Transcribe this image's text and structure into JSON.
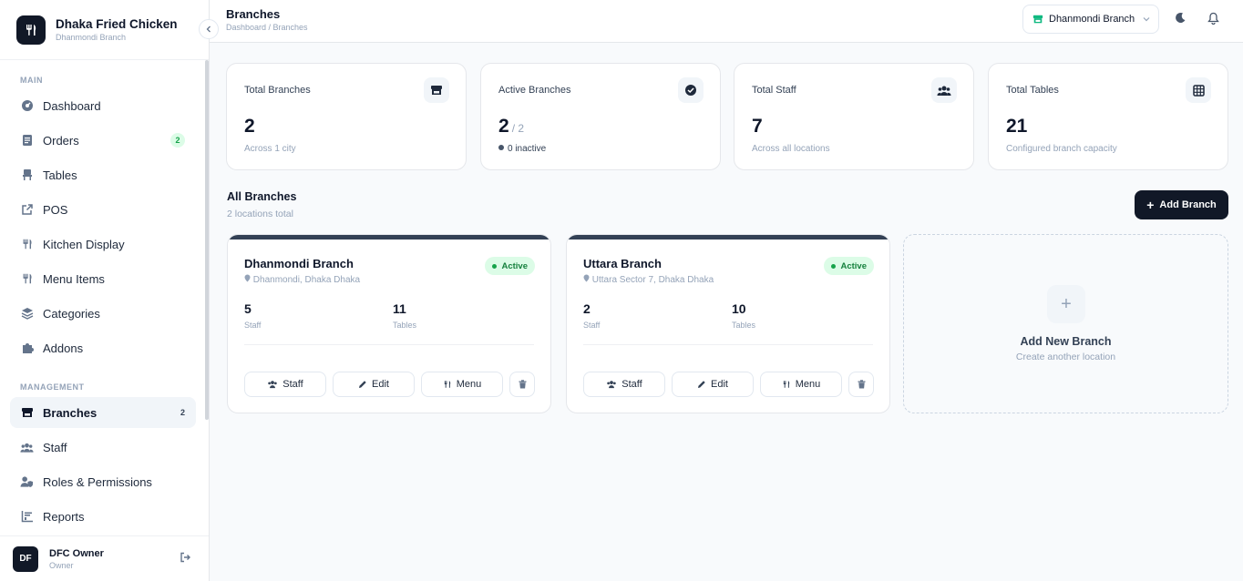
{
  "brand": {
    "name": "Dhaka Fried Chicken",
    "branch": "Dhanmondi Branch"
  },
  "sidebar": {
    "main_label": "MAIN",
    "main_items": [
      {
        "label": "Dashboard",
        "icon": "dashboard-icon"
      },
      {
        "label": "Orders",
        "icon": "orders-icon",
        "badge": "2"
      },
      {
        "label": "Tables",
        "icon": "chair-icon"
      },
      {
        "label": "POS",
        "icon": "external-link-icon"
      },
      {
        "label": "Kitchen Display",
        "icon": "utensils-icon"
      },
      {
        "label": "Menu Items",
        "icon": "utensils-icon"
      },
      {
        "label": "Categories",
        "icon": "layers-icon"
      },
      {
        "label": "Addons",
        "icon": "puzzle-icon"
      }
    ],
    "management_label": "MANAGEMENT",
    "management_items": [
      {
        "label": "Branches",
        "icon": "store-icon",
        "badge": "2",
        "active": true
      },
      {
        "label": "Staff",
        "icon": "users-icon"
      },
      {
        "label": "Roles & Permissions",
        "icon": "user-shield-icon"
      },
      {
        "label": "Reports",
        "icon": "chart-icon"
      }
    ]
  },
  "user": {
    "initials": "DF",
    "name": "DFC Owner",
    "role": "Owner"
  },
  "header": {
    "title": "Branches",
    "breadcrumb": "Dashboard / Branches",
    "branch_selector": "Dhanmondi Branch"
  },
  "stats": [
    {
      "title": "Total Branches",
      "value": "2",
      "sub": "Across 1 city",
      "icon": "store-icon"
    },
    {
      "title": "Active Branches",
      "value": "2",
      "of": "/ 2",
      "sub": "0 inactive",
      "icon": "check-circle-icon"
    },
    {
      "title": "Total Staff",
      "value": "7",
      "sub": "Across all locations",
      "icon": "users-icon"
    },
    {
      "title": "Total Tables",
      "value": "21",
      "sub": "Configured branch capacity",
      "icon": "grid-icon"
    }
  ],
  "all_branches": {
    "title": "All Branches",
    "subtitle": "2 locations total",
    "add_button": "Add Branch"
  },
  "branches": [
    {
      "name": "Dhanmondi Branch",
      "location": "Dhanmondi, Dhaka Dhaka",
      "status": "Active",
      "staff": "5",
      "staff_label": "Staff",
      "tables": "11",
      "tables_label": "Tables"
    },
    {
      "name": "Uttara Branch",
      "location": "Uttara Sector 7, Dhaka Dhaka",
      "status": "Active",
      "staff": "2",
      "staff_label": "Staff",
      "tables": "10",
      "tables_label": "Tables"
    }
  ],
  "card_actions": {
    "staff": "Staff",
    "edit": "Edit",
    "menu": "Menu"
  },
  "add_card": {
    "title": "Add New Branch",
    "subtitle": "Create another location"
  },
  "colors": {
    "primary": "#111827",
    "active_bg": "#dcfce7",
    "active_text": "#15803d",
    "card_topbar": "#334155"
  }
}
